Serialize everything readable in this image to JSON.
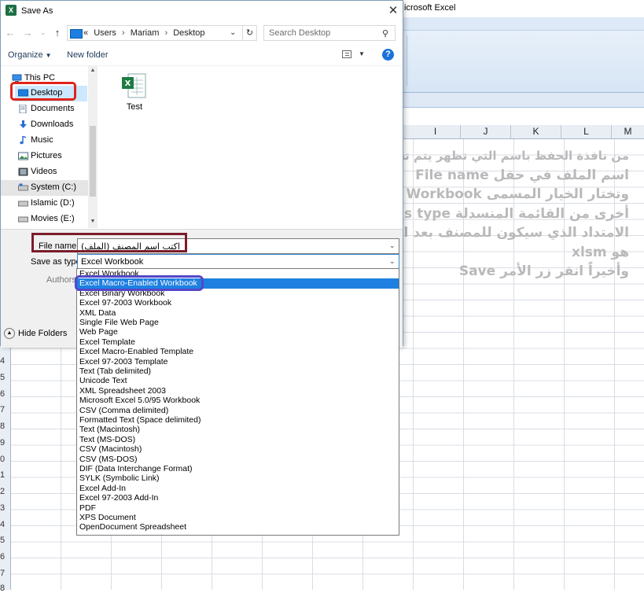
{
  "excel": {
    "title_fragment": "icrosoft Excel",
    "columns": [
      "I",
      "J",
      "K",
      "L",
      "M"
    ],
    "row_numbers": [
      "4",
      "5",
      "6",
      "7",
      "8",
      "9",
      "0",
      "1",
      "2",
      "3",
      "4",
      "5",
      "6",
      "7",
      "8"
    ]
  },
  "overlay": {
    "lines": [
      "من نافذة الحفظ باسم التي تظهر يتم تحديد المسار المراد حفظ المصنف فيه كما يمكنك أن تكتب",
      "اسم الملف في حقل File name",
      "وتختار الخيار المسمى Excel Macro-Enabled Workbook ويمكن اختيار خيارات",
      "أخرى من القائمة المنسدلة Save as type",
      "الامتداد الذي سيكون للمصنف بعد اختيار الخيار Excel Macro-Enabled Workbook",
      "هو xlsm",
      "وأخيراً انقر زر الأمر Save"
    ]
  },
  "dialog": {
    "title": "Save As",
    "close": "✕",
    "address": {
      "prefix": "«",
      "segments": [
        "Users",
        "Mariam",
        "Desktop"
      ],
      "separator": "›"
    },
    "search_placeholder": "Search Desktop",
    "toolbar": {
      "organize": "Organize",
      "new_folder": "New folder",
      "help": "?"
    },
    "nav": [
      {
        "label": "This PC",
        "icon": "computer-icon"
      },
      {
        "label": "Desktop",
        "icon": "desktop-icon"
      },
      {
        "label": "Documents",
        "icon": "documents-icon"
      },
      {
        "label": "Downloads",
        "icon": "downloads-icon"
      },
      {
        "label": "Music",
        "icon": "music-icon"
      },
      {
        "label": "Pictures",
        "icon": "pictures-icon"
      },
      {
        "label": "Videos",
        "icon": "videos-icon"
      },
      {
        "label": "System (C:)",
        "icon": "drive-icon"
      },
      {
        "label": "Islamic (D:)",
        "icon": "drive-icon"
      },
      {
        "label": "Movies (E:)",
        "icon": "drive-icon"
      }
    ],
    "files": [
      {
        "name": "Test",
        "icon": "excel-file-icon"
      }
    ],
    "form": {
      "file_name_label": "File name:",
      "file_name_value": "اكتب اسم المصنف (الملف)",
      "save_type_label": "Save as type:",
      "save_type_value": "Excel Workbook",
      "authors_label": "Authors",
      "hide_folders": "Hide Folders"
    },
    "save_types": [
      "Excel Workbook",
      "Excel Macro-Enabled Workbook",
      "Excel Binary Workbook",
      "Excel 97-2003 Workbook",
      "XML Data",
      "Single File Web Page",
      "Web Page",
      "Excel Template",
      "Excel Macro-Enabled Template",
      "Excel 97-2003 Template",
      "Text (Tab delimited)",
      "Unicode Text",
      "XML Spreadsheet 2003",
      "Microsoft Excel 5.0/95 Workbook",
      "CSV (Comma delimited)",
      "Formatted Text (Space delimited)",
      "Text (Macintosh)",
      "Text (MS-DOS)",
      "CSV (Macintosh)",
      "CSV (MS-DOS)",
      "DIF (Data Interchange Format)",
      "SYLK (Symbolic Link)",
      "Excel Add-In",
      "Excel 97-2003 Add-In",
      "PDF",
      "XPS Document",
      "OpenDocument Spreadsheet"
    ],
    "selected_type_index": 1
  },
  "colors": {
    "selection": "#1e80e0",
    "red_highlight": "#e0241b",
    "maroon_highlight": "#7a1c2a",
    "purple_highlight": "#5447c9",
    "overlay_text": "#b9b9b9"
  }
}
